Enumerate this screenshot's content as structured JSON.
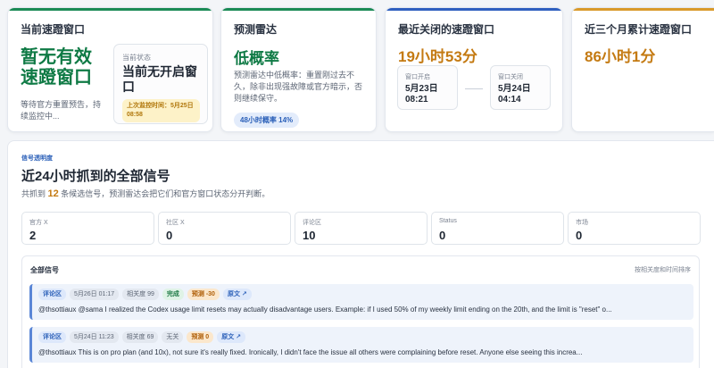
{
  "colors": {
    "green": "#0f7a45",
    "amber": "#c47a12",
    "blue": "#2a5fb8",
    "topbar_green": "#1a8a55",
    "topbar_amber": "#d99a2b",
    "topbar_blue": "#2f5fbf"
  },
  "current_window": {
    "title": "当前速蹬窗口",
    "status_text": "暂无有效速蹬窗口",
    "desc": "等待官方重置预告，持续监控中...",
    "box_label": "当前状态",
    "box_value": "当前无开启窗口",
    "last_monitored": "上次监控时间：5月25日 08:58"
  },
  "forecast": {
    "title": "预测雷达",
    "level": "低概率",
    "desc": "预测雷达中低概率：重置刚过去不久，除非出现强故障或官方暗示，否则继续保守。",
    "pill": "48小时概率 14%"
  },
  "last_closed": {
    "title": "最近关闭的速蹬窗口",
    "duration": "19小时53分",
    "open_label": "窗口开启",
    "open_value": "5月23日 08:21",
    "close_label": "窗口关闭",
    "close_value": "5月24日 04:14"
  },
  "three_months": {
    "title": "近三个月累计速蹬窗口",
    "total": "86小时1分"
  },
  "signals": {
    "eyebrow": "信号透明度",
    "heading": "近24小时抓到的全部信号",
    "summary_prefix": "共抓到",
    "summary_count": "12",
    "summary_suffix": "条候选信号，预测雷达会把它们和官方窗口状态分开判断。",
    "stats": [
      {
        "label": "官方 X",
        "value": "2"
      },
      {
        "label": "社区 X",
        "value": "0"
      },
      {
        "label": "评论区",
        "value": "10"
      },
      {
        "label": "Status",
        "value": "0"
      },
      {
        "label": "市场",
        "value": "0"
      }
    ],
    "list_title": "全部信号",
    "sort_label": "按相关度和时间排序",
    "items": [
      {
        "source": "评论区",
        "time": "5月26日 01:17",
        "relevance": "相关度 99",
        "label": "完成",
        "prediction": "预测 -30",
        "link": "原文 ↗",
        "text": "@thsottiaux @sama I realized the Codex usage limit resets may actually disadvantage users. Example: if I used 50% of my weekly limit ending on the 20th, and the limit is \"reset\" o..."
      },
      {
        "source": "评论区",
        "time": "5月24日 11:23",
        "relevance": "相关度 69",
        "label": "无关",
        "prediction": "预测 0",
        "link": "原文 ↗",
        "text": "@thsottiaux This is on pro plan (and 10x), not sure it's really fixed. Ironically, I didn't face the issue all others were complaining before reset. Anyone else seeing this increa..."
      }
    ]
  }
}
